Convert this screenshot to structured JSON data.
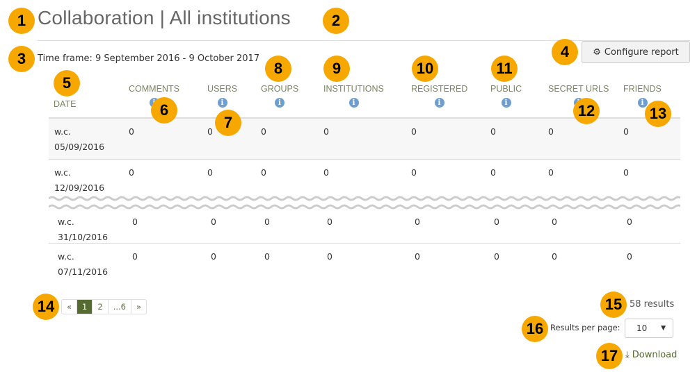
{
  "title": "Collaboration | All institutions",
  "time_frame": "Time frame: 9 September 2016 - 9 October 2017",
  "configure_label": "Configure report",
  "columns": [
    "DATE",
    "COMMENTS",
    "USERS",
    "GROUPS",
    "INSTITUTIONS",
    "REGISTERED",
    "PUBLIC",
    "SECRET URLS",
    "FRIENDS"
  ],
  "rows": [
    {
      "date1": "w.c.",
      "date2": "05/09/2016",
      "values": [
        "0",
        "0",
        "0",
        "0",
        "0",
        "0",
        "0",
        "0"
      ]
    },
    {
      "date1": "w.c.",
      "date2": "12/09/2016",
      "values": [
        "0",
        "0",
        "0",
        "0",
        "0",
        "0",
        "0",
        "0"
      ]
    },
    {
      "date1": "w.c.",
      "date2": "31/10/2016",
      "values": [
        "0",
        "0",
        "0",
        "0",
        "0",
        "0",
        "0",
        "0"
      ]
    },
    {
      "date1": "w.c.",
      "date2": "07/11/2016",
      "values": [
        "0",
        "0",
        "0",
        "0",
        "0",
        "0",
        "0",
        "0"
      ]
    }
  ],
  "pagination": {
    "prev": "«",
    "pages": [
      "1",
      "2",
      "...6"
    ],
    "next": "»",
    "current": "1"
  },
  "results": "58 results",
  "per_page_label": "Results per page:",
  "per_page_value": "10",
  "download_label": "Download",
  "badges": [
    "1",
    "2",
    "3",
    "4",
    "5",
    "6",
    "7",
    "8",
    "9",
    "10",
    "11",
    "12",
    "13",
    "14",
    "15",
    "16",
    "17"
  ],
  "colors": {
    "accent": "#556b2f",
    "badge": "#f7a800",
    "info": "#6e9dd0"
  }
}
